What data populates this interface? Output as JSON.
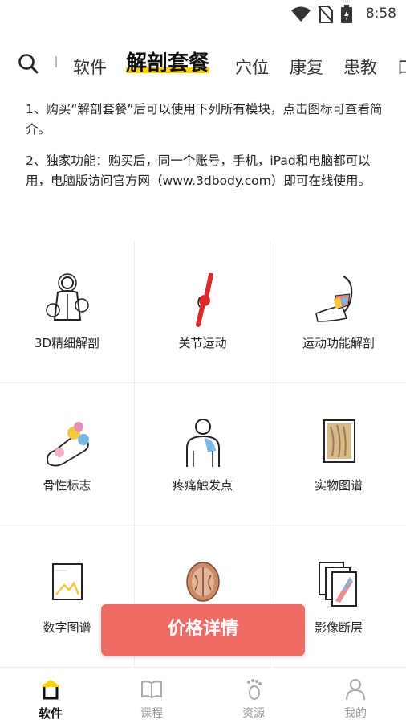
{
  "status": {
    "time": "8:58"
  },
  "tabs": [
    "软件",
    "解剖套餐",
    "穴位",
    "康复",
    "患教",
    "口"
  ],
  "intro": {
    "p1_a": "1、购买“解剖套餐”后可以使用下列所有模块，",
    "p1_b": "点击图标可查看简介。",
    "p2": "2、独家功能：购买后，同一个账号，手机，iPad和电脑都可以用，电脑版访问官方网（www.3dbody.com）即可在线使用。"
  },
  "modules": [
    {
      "label": "3D精细解剖",
      "icon": "body-anatomy-icon"
    },
    {
      "label": "关节运动",
      "icon": "knee-joint-icon"
    },
    {
      "label": "运动功能解剖",
      "icon": "shoulder-muscle-icon"
    },
    {
      "label": "骨性标志",
      "icon": "bone-landmark-icon"
    },
    {
      "label": "疼痛触发点",
      "icon": "trigger-point-icon"
    },
    {
      "label": "实物图谱",
      "icon": "specimen-photo-icon"
    },
    {
      "label": "数字图谱",
      "icon": "digital-atlas-icon"
    },
    {
      "label": "",
      "icon": "brain-section-icon"
    },
    {
      "label": "影像断层",
      "icon": "imaging-slice-icon"
    }
  ],
  "price_button": "价格详情",
  "bottom_nav": [
    "软件",
    "课程",
    "资源",
    "我的"
  ],
  "colors": {
    "accent_yellow": "#ffd200",
    "button_red": "#ee6b66"
  }
}
